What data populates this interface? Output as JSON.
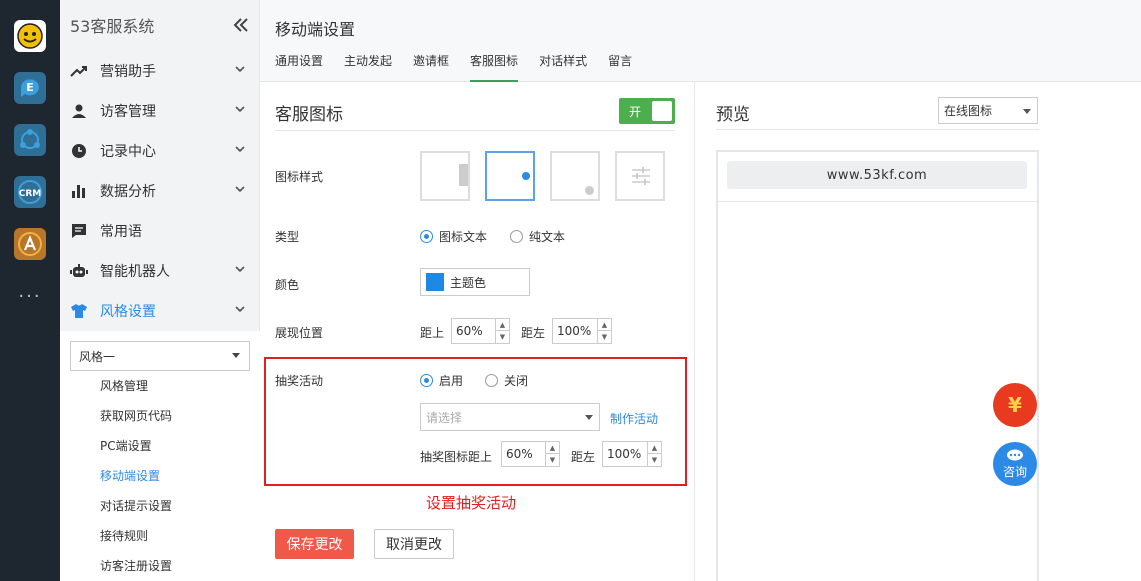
{
  "app": {
    "title": "53客服系统"
  },
  "rail": {
    "icons": [
      "53kf-logo-icon",
      "chat-e-icon",
      "network-icon",
      "crm-icon",
      "a-app-icon"
    ],
    "more": "···"
  },
  "sidebar": {
    "items": [
      {
        "label": "营销助手",
        "icon": "trend-up-icon"
      },
      {
        "label": "访客管理",
        "icon": "person-icon"
      },
      {
        "label": "记录中心",
        "icon": "clock-icon"
      },
      {
        "label": "数据分析",
        "icon": "bar-chart-icon"
      },
      {
        "label": "常用语",
        "icon": "message-icon"
      },
      {
        "label": "智能机器人",
        "icon": "robot-icon"
      },
      {
        "label": "风格设置",
        "icon": "tshirt-icon"
      }
    ],
    "style_select": "风格一",
    "sub_items": [
      "风格管理",
      "获取网页代码",
      "PC端设置",
      "移动端设置",
      "对话提示设置",
      "接待规则",
      "访客注册设置"
    ]
  },
  "header": {
    "title": "移动端设置",
    "tabs": [
      "通用设置",
      "主动发起",
      "邀请框",
      "客服图标",
      "对话样式",
      "留言"
    ]
  },
  "section": {
    "title": "客服图标",
    "toggle_label": "开"
  },
  "form": {
    "icon_style_label": "图标样式",
    "type_label": "类型",
    "type_options": [
      "图标文本",
      "纯文本"
    ],
    "color_label": "颜色",
    "color_value": "主题色",
    "color_hex": "#1e88e5",
    "position_label": "展现位置",
    "top_label": "距上",
    "top_value": "60%",
    "left_label": "距左",
    "left_value": "100%",
    "lottery_label": "抽奖活动",
    "lottery_options": [
      "启用",
      "关闭"
    ],
    "lottery_placeholder": "请选择",
    "make_activity": "制作活动",
    "lottery_top_label": "抽奖图标距上",
    "lottery_top_value": "60%",
    "lottery_left_label": "距左",
    "lottery_left_value": "100%",
    "annotation": "设置抽奖活动",
    "save": "保存更改",
    "cancel": "取消更改"
  },
  "preview": {
    "title": "预览",
    "select": "在线图标",
    "url": "www.53kf.com",
    "lottery_icon": "¥",
    "consult_label": "咨询"
  }
}
